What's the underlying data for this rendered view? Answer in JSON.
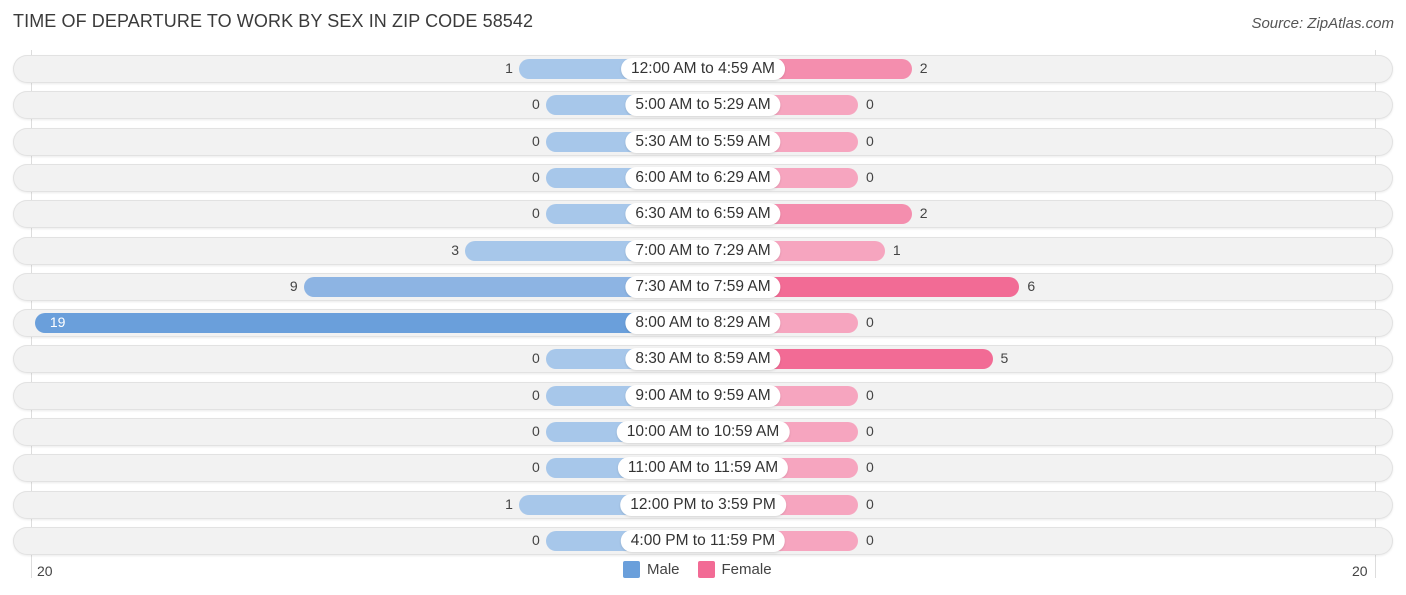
{
  "title": "TIME OF DEPARTURE TO WORK BY SEX IN ZIP CODE 58542",
  "source": "Source: ZipAtlas.com",
  "chart_data": {
    "type": "bar",
    "orientation": "horizontal-diverging",
    "title": "TIME OF DEPARTURE TO WORK BY SEX IN ZIP CODE 58542",
    "categories": [
      "12:00 AM to 4:59 AM",
      "5:00 AM to 5:29 AM",
      "5:30 AM to 5:59 AM",
      "6:00 AM to 6:29 AM",
      "6:30 AM to 6:59 AM",
      "7:00 AM to 7:29 AM",
      "7:30 AM to 7:59 AM",
      "8:00 AM to 8:29 AM",
      "8:30 AM to 8:59 AM",
      "9:00 AM to 9:59 AM",
      "10:00 AM to 10:59 AM",
      "11:00 AM to 11:59 AM",
      "12:00 PM to 3:59 PM",
      "4:00 PM to 11:59 PM"
    ],
    "series": [
      {
        "name": "Male",
        "color": "#6a9fdb",
        "values": [
          1,
          0,
          0,
          0,
          0,
          3,
          9,
          19,
          0,
          0,
          0,
          0,
          1,
          0
        ]
      },
      {
        "name": "Female",
        "color": "#f26b95",
        "values": [
          2,
          0,
          0,
          0,
          2,
          1,
          6,
          0,
          5,
          0,
          0,
          0,
          0,
          0
        ]
      }
    ],
    "axis": {
      "left_tick": "20",
      "right_tick": "20",
      "range": [
        -20,
        20
      ]
    },
    "legend": {
      "position": "bottom-center",
      "entries": [
        "Male",
        "Female"
      ]
    }
  }
}
